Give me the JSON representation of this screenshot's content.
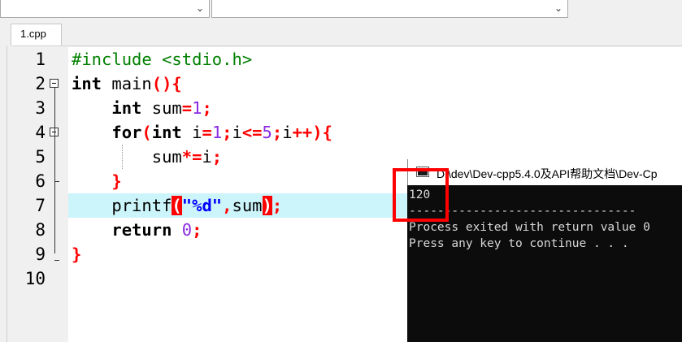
{
  "file_tab": {
    "label": "1.cpp"
  },
  "code": {
    "line_numbers": [
      "1",
      "2",
      "3",
      "4",
      "5",
      "6",
      "7",
      "8",
      "9",
      "10"
    ],
    "lines": [
      [
        {
          "t": "#include <stdio.h>",
          "c": "pp"
        }
      ],
      [
        {
          "t": "int",
          "c": "kw"
        },
        {
          "t": " main",
          "c": ""
        },
        {
          "t": "(){",
          "c": "op"
        }
      ],
      [
        {
          "t": "    ",
          "c": ""
        },
        {
          "t": "int",
          "c": "kw"
        },
        {
          "t": " sum",
          "c": ""
        },
        {
          "t": "=",
          "c": "op"
        },
        {
          "t": "1",
          "c": "num"
        },
        {
          "t": ";",
          "c": "op"
        }
      ],
      [
        {
          "t": "    ",
          "c": ""
        },
        {
          "t": "for",
          "c": "kw"
        },
        {
          "t": "(",
          "c": "op"
        },
        {
          "t": "int",
          "c": "kw"
        },
        {
          "t": " i",
          "c": ""
        },
        {
          "t": "=",
          "c": "op"
        },
        {
          "t": "1",
          "c": "num"
        },
        {
          "t": ";",
          "c": "op"
        },
        {
          "t": "i",
          "c": ""
        },
        {
          "t": "<=",
          "c": "op"
        },
        {
          "t": "5",
          "c": "num"
        },
        {
          "t": ";",
          "c": "op"
        },
        {
          "t": "i",
          "c": ""
        },
        {
          "t": "++){",
          "c": "op"
        }
      ],
      [
        {
          "t": "        sum",
          "c": ""
        },
        {
          "t": "*=",
          "c": "op"
        },
        {
          "t": "i",
          "c": ""
        },
        {
          "t": ";",
          "c": "op"
        }
      ],
      [
        {
          "t": "    ",
          "c": ""
        },
        {
          "t": "}",
          "c": "op"
        }
      ],
      [
        {
          "t": "    printf",
          "c": ""
        },
        {
          "t": "(",
          "c": "bm"
        },
        {
          "t": "\"%d\"",
          "c": "str"
        },
        {
          "t": ",",
          "c": "op"
        },
        {
          "t": "sum",
          "c": ""
        },
        {
          "t": ")",
          "c": "bm"
        },
        {
          "t": ";",
          "c": "op"
        }
      ],
      [
        {
          "t": "    ",
          "c": ""
        },
        {
          "t": "return",
          "c": "kw"
        },
        {
          "t": " ",
          "c": ""
        },
        {
          "t": "0",
          "c": "num"
        },
        {
          "t": ";",
          "c": "op"
        }
      ],
      [
        {
          "t": "}",
          "c": "op"
        }
      ],
      []
    ]
  },
  "console": {
    "title": "D:\\dev\\Dev-cpp5.4.0及API帮助文档\\Dev-Cp",
    "lines": [
      "120",
      "--------------------------------",
      "Process exited with return value 0",
      "Press any key to continue . . ."
    ]
  },
  "colors": {
    "preprocessor": "#008000",
    "number": "#8a2be2",
    "operator": "#ff0000",
    "string": "#0000ff",
    "current_line": "#cbf5fb",
    "annotation_box": "#ff0000"
  }
}
